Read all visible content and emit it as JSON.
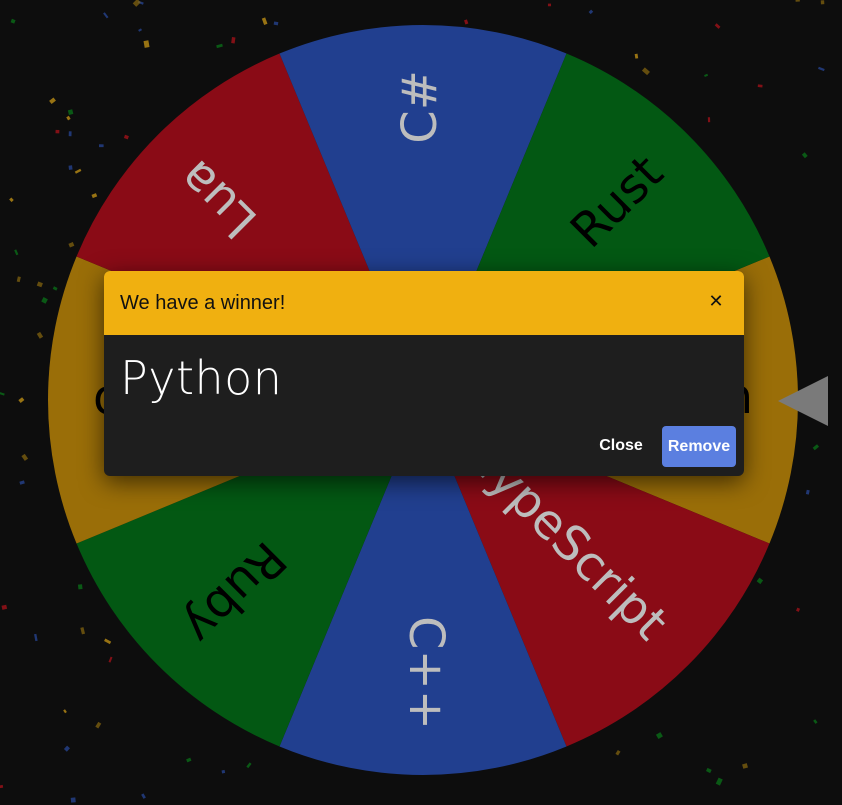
{
  "wheel": {
    "slices": [
      {
        "label": "Python",
        "color": "#9a6e08",
        "text_color": "#000000"
      },
      {
        "label": "TypeScript",
        "color": "#8a0b16",
        "text_color": "#bdbdbd"
      },
      {
        "label": "C++",
        "color": "#213f8f",
        "text_color": "#bdbdbd"
      },
      {
        "label": "Ruby",
        "color": "#035813",
        "text_color": "#000000"
      },
      {
        "label": "Go",
        "color": "#9a6e08",
        "text_color": "#000000"
      },
      {
        "label": "Lua",
        "color": "#8a0b16",
        "text_color": "#bdbdbd"
      },
      {
        "label": "C#",
        "color": "#213f8f",
        "text_color": "#bdbdbd"
      },
      {
        "label": "Rust",
        "color": "#035813",
        "text_color": "#000000"
      }
    ],
    "pointer_icon": "triangle-pointer-icon"
  },
  "dialog": {
    "title": "We have a winner!",
    "close_icon": "close-icon",
    "winner": "Python",
    "close_label": "Close",
    "remove_label": "Remove",
    "header_color": "#f0b010",
    "remove_color": "#5b7fe0"
  }
}
